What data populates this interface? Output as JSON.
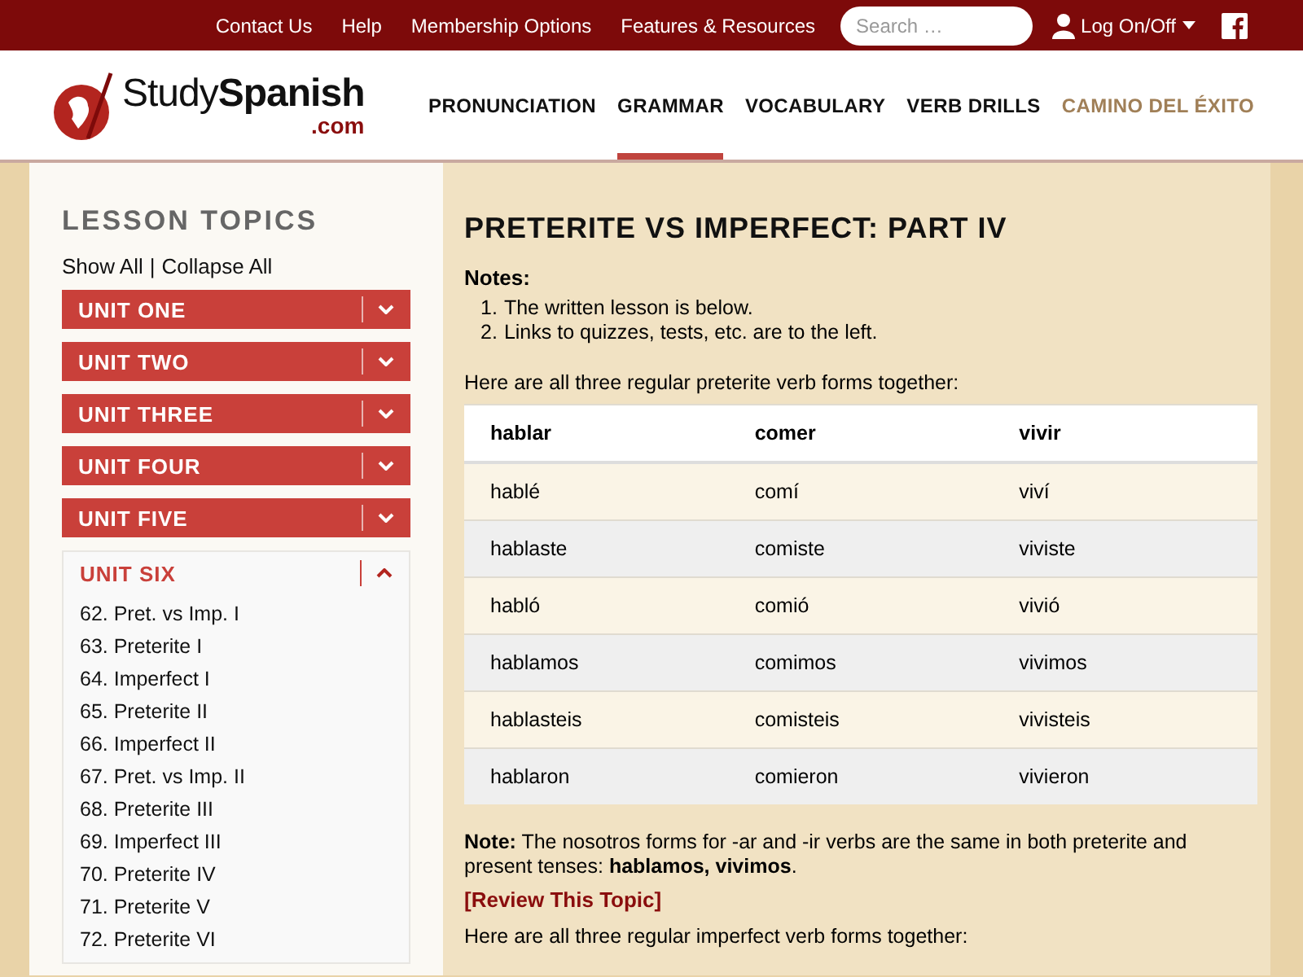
{
  "top_bar": {
    "links": [
      "Contact Us",
      "Help",
      "Membership Options",
      "Features & Resources"
    ],
    "search": {
      "placeholder": "Search …"
    },
    "login": "Log On/Off"
  },
  "logo": {
    "name": "Study**Spanish**",
    "suffix": ".com"
  },
  "nav": [
    {
      "label": "PRONUNCIATION",
      "selected": false,
      "kind": "normal"
    },
    {
      "label": "GRAMMAR",
      "selected": true,
      "kind": "normal"
    },
    {
      "label": "VOCABULARY",
      "selected": false,
      "kind": "normal"
    },
    {
      "label": "VERB DRILLS",
      "selected": false,
      "kind": "normal"
    },
    {
      "label": "CAMINO DEL ÉXITO",
      "selected": false,
      "kind": "special"
    }
  ],
  "sidebar": {
    "title": "LESSON TOPICS",
    "show_all": "Show All",
    "separator": "|",
    "collapse_all": "Collapse All",
    "units": [
      {
        "label": "UNIT ONE",
        "expanded": false
      },
      {
        "label": "UNIT TWO",
        "expanded": false
      },
      {
        "label": "UNIT THREE",
        "expanded": false
      },
      {
        "label": "UNIT FOUR",
        "expanded": false
      },
      {
        "label": "UNIT FIVE",
        "expanded": false
      },
      {
        "label": "UNIT SIX",
        "expanded": true,
        "children": [
          "62. Pret. vs Imp. I",
          "63. Preterite I",
          "64. Imperfect I",
          "65. Preterite II",
          "66. Imperfect II",
          "67. Pret. vs Imp. II",
          "68. Preterite III",
          "69. Imperfect III",
          "70. Preterite IV",
          "71. Preterite V",
          "72. Preterite VI"
        ]
      }
    ]
  },
  "main": {
    "title": "PRETERITE VS IMPERFECT: PART IV",
    "notes_label": "Notes:",
    "notes": [
      {
        "number": "1.",
        "text": "The written lesson is below."
      },
      {
        "number": "2.",
        "text": "Links to quizzes, tests, etc. are to the left."
      }
    ],
    "intro": "Here are all three regular preterite verb forms together:",
    "table": {
      "columns": [
        "hablar",
        "comer",
        "vivir"
      ],
      "rows": [
        [
          "hablé",
          "comí",
          "viví"
        ],
        [
          "hablaste",
          "comiste",
          "viviste"
        ],
        [
          "habló",
          "comió",
          "vivió"
        ],
        [
          "hablamos",
          "comimos",
          "vivimos"
        ],
        [
          "hablasteis",
          "comisteis",
          "vivisteis"
        ],
        [
          "hablaron",
          "comieron",
          "vivieron"
        ]
      ]
    },
    "note": "**Note:** The nosotros forms for -ar and -ir verbs are the same in both preterite and present tenses: **hablamos, vivimos**.",
    "review_link": "[Review This Topic]",
    "next_intro": "Here are all three regular imperfect verb forms together:"
  }
}
